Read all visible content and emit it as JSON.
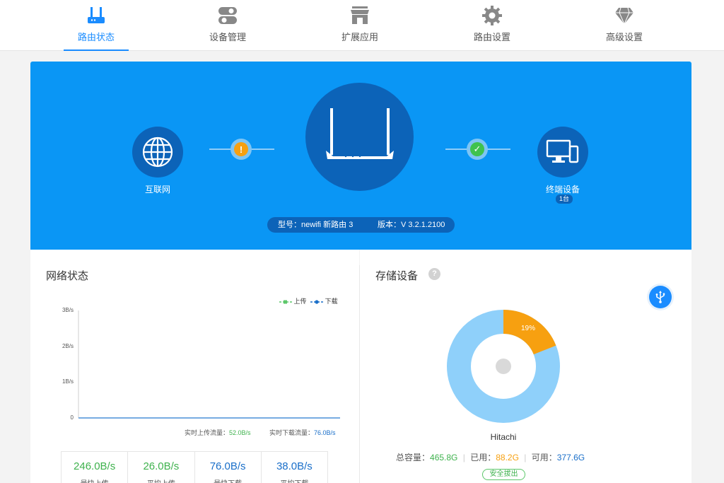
{
  "nav": {
    "items": [
      {
        "label": "路由状态",
        "icon": "router-icon",
        "active": true
      },
      {
        "label": "设备管理",
        "icon": "toggle-icon"
      },
      {
        "label": "扩展应用",
        "icon": "store-icon"
      },
      {
        "label": "路由设置",
        "icon": "gear-icon"
      },
      {
        "label": "高级设置",
        "icon": "diamond-icon"
      }
    ]
  },
  "hero": {
    "internet_label": "互联网",
    "devices_label": "终端设备",
    "devices_count": "1台",
    "model_text": "型号：newifi 新路由 3",
    "version_text": "版本：V 3.2.1.2100",
    "wan_status": "warning",
    "lan_status": "ok"
  },
  "network": {
    "title": "网络状态",
    "legend_upload": "上传",
    "legend_download": "下载",
    "realtime_upload_label": "实时上传流量：",
    "realtime_upload_value": "52.0B/s",
    "realtime_download_label": "实时下载流量：",
    "realtime_download_value": "76.0B/s",
    "stats": [
      {
        "value": "246.0B/s",
        "label": "最快上传",
        "color": "#3fb24e"
      },
      {
        "value": "26.0B/s",
        "label": "平均上传",
        "color": "#3fb24e"
      },
      {
        "value": "76.0B/s",
        "label": "最快下载",
        "color": "#1a6fc9"
      },
      {
        "value": "38.0B/s",
        "label": "平均下载",
        "color": "#1a6fc9"
      }
    ]
  },
  "chart_data": {
    "type": "line",
    "yticks": [
      "3B/s",
      "2B/s",
      "1B/s",
      "0"
    ],
    "ylim": [
      0,
      3
    ],
    "series": [
      {
        "name": "上传",
        "color": "#5cc76a",
        "values": []
      },
      {
        "name": "下载",
        "color": "#1a6fc9",
        "values": []
      }
    ],
    "legend": "top-right"
  },
  "storage": {
    "title": "存储设备",
    "help_icon": "?",
    "usb_icon": "usb-icon",
    "disk_name": "Hitachi",
    "used_percent_label": "19%",
    "used_fraction": 0.19,
    "total_label": "总容量：",
    "total_value": "465.8G",
    "used_label": "已用：",
    "used_value": "88.2G",
    "free_label": "可用：",
    "free_value": "377.6G",
    "eject_label": "安全拔出",
    "colors": {
      "used": "#f7a010",
      "free": "#8fd0fa"
    }
  }
}
